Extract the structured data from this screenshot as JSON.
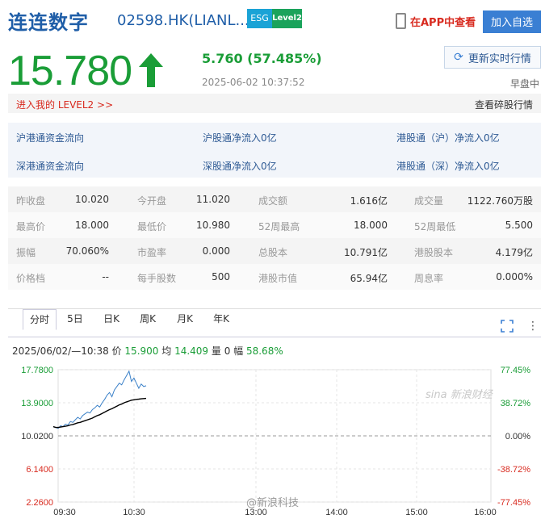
{
  "header": {
    "name": "连连数字",
    "code": "02598.HK(LIANL...)",
    "esg_badge": "ESG",
    "level2_badge": "Level2",
    "app_link": "在APP中查看",
    "add_button": "加入自选"
  },
  "quote": {
    "price": "15.780",
    "change": "5.760  (57.485%)",
    "timestamp": "2025-06-02 10:37:52",
    "refresh_button": "更新实时行情",
    "session": "早盘中",
    "price_color": "#1a9d37"
  },
  "l2bar": {
    "link": "进入我的 LEVEL2 >>",
    "tick_link": "查看碎股行情"
  },
  "flow": {
    "row1": [
      "沪港通资金流向",
      "沪股通净流入0亿",
      "港股通（沪）净流入0亿"
    ],
    "row2": [
      "深港通资金流向",
      "深股通净流入0亿",
      "港股通（深）净流入0亿"
    ]
  },
  "stats": [
    [
      [
        "昨收盘",
        "10.020"
      ],
      [
        "今开盘",
        "11.020"
      ],
      [
        "成交额",
        "1.616亿"
      ],
      [
        "成交量",
        "1122.760万股"
      ]
    ],
    [
      [
        "最高价",
        "18.000"
      ],
      [
        "最低价",
        "10.980"
      ],
      [
        "52周最高",
        "18.000"
      ],
      [
        "52周最低",
        "5.500"
      ]
    ],
    [
      [
        "振幅",
        "70.060%"
      ],
      [
        "市盈率",
        "0.000"
      ],
      [
        "总股本",
        "10.791亿"
      ],
      [
        "港股股本",
        "4.179亿"
      ]
    ],
    [
      [
        "价格档",
        "--"
      ],
      [
        "每手股数",
        "500"
      ],
      [
        "港股市值",
        "65.94亿"
      ],
      [
        "周息率",
        "0.000%"
      ]
    ]
  ],
  "tabs": [
    "分时",
    "5日",
    "日K",
    "周K",
    "月K",
    "年K"
  ],
  "chart_info": {
    "prefix": "2025/06/02/—10:38 价 ",
    "price": "15.900",
    "avg_label": " 均 ",
    "avg": "14.409",
    "vol_label": " 量 0 幅 ",
    "amp": "58.68%"
  },
  "watermarks": {
    "sina": "sina 新浪财经",
    "weibo": "@新浪科技"
  },
  "chart_data": {
    "type": "line",
    "x_ticks": [
      "09:30",
      "10:30",
      "13:00",
      "14:00",
      "15:00",
      "16:00"
    ],
    "y_left": [
      "17.7800",
      "13.9000",
      "10.0200",
      "6.1400",
      "2.2600"
    ],
    "y_right": [
      "77.45%",
      "38.72%",
      "0.00%",
      "-38.72%",
      "-77.45%"
    ],
    "ylim": [
      2.26,
      17.78
    ],
    "prev_close": 10.02,
    "series": [
      {
        "color": "#3a80c8",
        "values": [
          11.1,
          11.0,
          10.9,
          11.2,
          11.1,
          11.4,
          11.3,
          11.7,
          11.6,
          11.9,
          12.2,
          12.0,
          12.4,
          12.6,
          12.8,
          12.7,
          13.1,
          13.3,
          13.6,
          13.4,
          13.9,
          14.3,
          14.8,
          15.1,
          14.6,
          15.4,
          15.8,
          16.2,
          16.0,
          16.6,
          17.1,
          17.6,
          16.4,
          16.8,
          16.2,
          15.6,
          16.1,
          15.8,
          15.9
        ]
      },
      {
        "color": "#000000",
        "values": [
          11.1,
          11.0,
          11.0,
          11.05,
          11.1,
          11.15,
          11.2,
          11.3,
          11.35,
          11.45,
          11.55,
          11.6,
          11.7,
          11.8,
          11.9,
          12.0,
          12.1,
          12.25,
          12.4,
          12.5,
          12.65,
          12.8,
          12.95,
          13.1,
          13.2,
          13.35,
          13.5,
          13.65,
          13.75,
          13.9,
          14.0,
          14.1,
          14.2,
          14.25,
          14.3,
          14.33,
          14.36,
          14.39,
          14.41
        ]
      }
    ]
  }
}
